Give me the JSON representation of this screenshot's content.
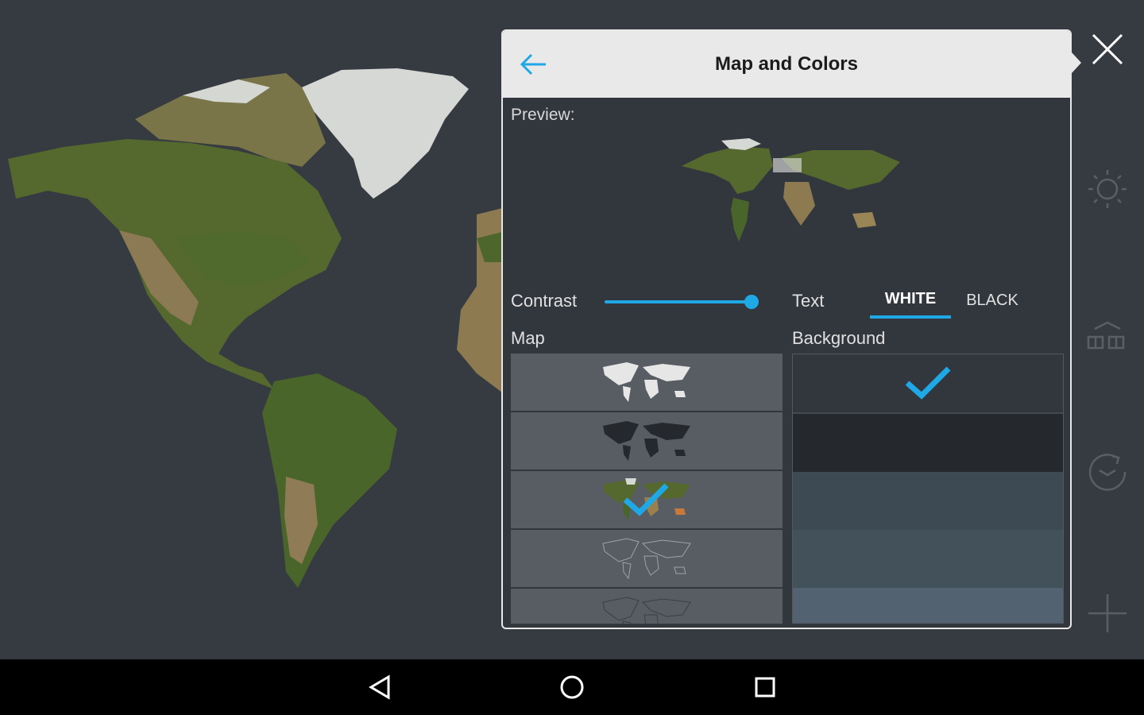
{
  "panel": {
    "title": "Map and Colors",
    "back_icon": "arrow-left-icon",
    "preview_label": "Preview:",
    "contrast_label": "Contrast",
    "contrast_level": 1.0,
    "text_label": "Text",
    "text_options": [
      "WHITE",
      "BLACK"
    ],
    "text_selected": "WHITE",
    "map_label": "Map",
    "background_label": "Background",
    "map_styles": [
      {
        "style": "white-silhouette",
        "selected": false
      },
      {
        "style": "dark-silhouette",
        "selected": false
      },
      {
        "style": "satellite",
        "selected": true
      },
      {
        "style": "outline",
        "selected": false
      },
      {
        "style": "dark-outline",
        "selected": false
      }
    ],
    "background_colors": [
      "#32373d",
      "#25292d",
      "#3d4a54",
      "#43515b",
      "#526270"
    ],
    "background_selected_index": 0
  },
  "side_rail": {
    "close_icon": "close-icon",
    "icons": [
      "sun-icon",
      "alarm-calendar-icon",
      "clock-sync-icon",
      "plus-icon"
    ]
  },
  "navbar": {
    "icons": [
      "back-triangle-icon",
      "home-circle-icon",
      "recents-square-icon"
    ]
  },
  "colors": {
    "accent": "#1fa8e6",
    "background": "#363b41",
    "header": "#e9e9e9"
  }
}
